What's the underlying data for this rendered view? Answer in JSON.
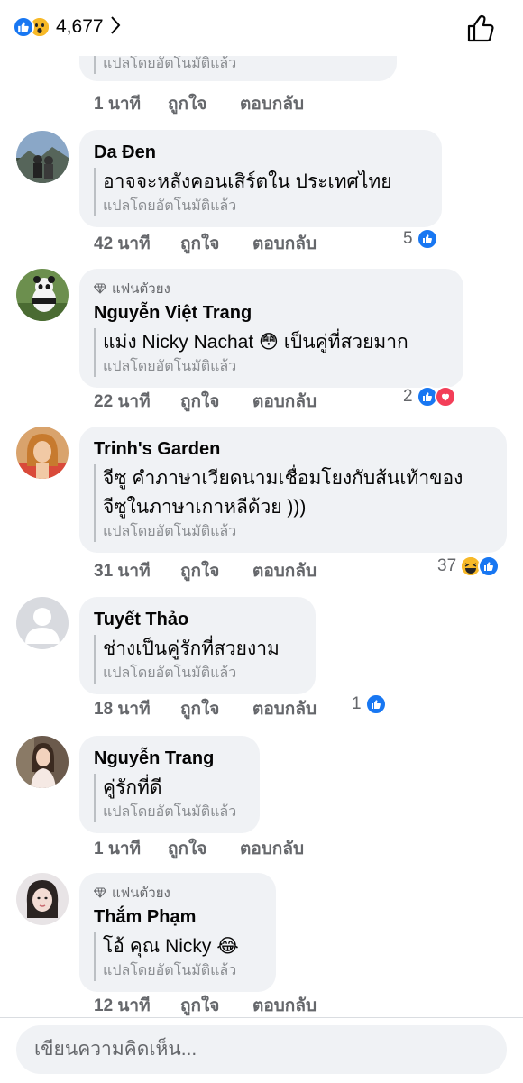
{
  "header": {
    "reaction_count": "4,677",
    "reaction_icons": [
      "like-icon",
      "wow-icon"
    ]
  },
  "top_partial": {
    "translated": "แปลโดยอัตโนมัติแล้ว",
    "time": "1 นาที",
    "like": "ถูกใจ",
    "reply": "ตอบกลับ"
  },
  "comments": [
    {
      "name": "Da Đen",
      "fan_badge": "",
      "text": "อาจจะหลังคอนเสิร์ตใน ประเทศไทย",
      "translated": "แปลโดยอัตโนมัติแล้ว",
      "time": "42 นาที",
      "like": "ถูกใจ",
      "reply": "ตอบกลับ",
      "reaction_count": "5",
      "reactions": [
        "like"
      ]
    },
    {
      "name": "Nguyễn Việt Trang",
      "fan_badge": "แฟนตัวยง",
      "text": "แม่ง Nicky Nachat 😳 เป็นคู่ที่สวยมาก",
      "translated": "แปลโดยอัตโนมัติแล้ว",
      "time": "22 นาที",
      "like": "ถูกใจ",
      "reply": "ตอบกลับ",
      "reaction_count": "2",
      "reactions": [
        "like",
        "love"
      ]
    },
    {
      "name": "Trinh's Garden",
      "fan_badge": "",
      "text_line1": "จีซู คำภาษาเวียดนามเชื่อมโยงกับส้นเท้าของ",
      "text_line2": "จีซูในภาษาเกาหลีด้วย )))",
      "translated": "แปลโดยอัตโนมัติแล้ว",
      "time": "31 นาที",
      "like": "ถูกใจ",
      "reply": "ตอบกลับ",
      "reaction_count": "37",
      "reactions": [
        "haha",
        "like"
      ]
    },
    {
      "name": "Tuyết Thảo",
      "fan_badge": "",
      "text": "ช่างเป็นคู่รักที่สวยงาม",
      "translated": "แปลโดยอัตโนมัติแล้ว",
      "time": "18 นาที",
      "like": "ถูกใจ",
      "reply": "ตอบกลับ",
      "reaction_count": "1",
      "reactions": [
        "like"
      ]
    },
    {
      "name": "Nguyễn Trang",
      "fan_badge": "",
      "text": "คู่รักที่ดี",
      "translated": "แปลโดยอัตโนมัติแล้ว",
      "time": "1 นาที",
      "like": "ถูกใจ",
      "reply": "ตอบกลับ",
      "reaction_count": "",
      "reactions": []
    },
    {
      "name": "Thắm Phạm",
      "fan_badge": "แฟนตัวยง",
      "text": "โอ้ คุณ Nicky 😂",
      "translated": "แปลโดยอัตโนมัติแล้ว",
      "time": "12 นาที",
      "like": "ถูกใจ",
      "reply": "ตอบกลับ",
      "reaction_count": "",
      "reactions": []
    }
  ],
  "composer": {
    "placeholder": "เขียนความคิดเห็น..."
  },
  "colors": {
    "like_blue": "#1877f2",
    "love_red": "#f33e58",
    "haha_yellow": "#f7b928",
    "bubble_bg": "#f0f2f5",
    "meta_gray": "#65676b"
  }
}
